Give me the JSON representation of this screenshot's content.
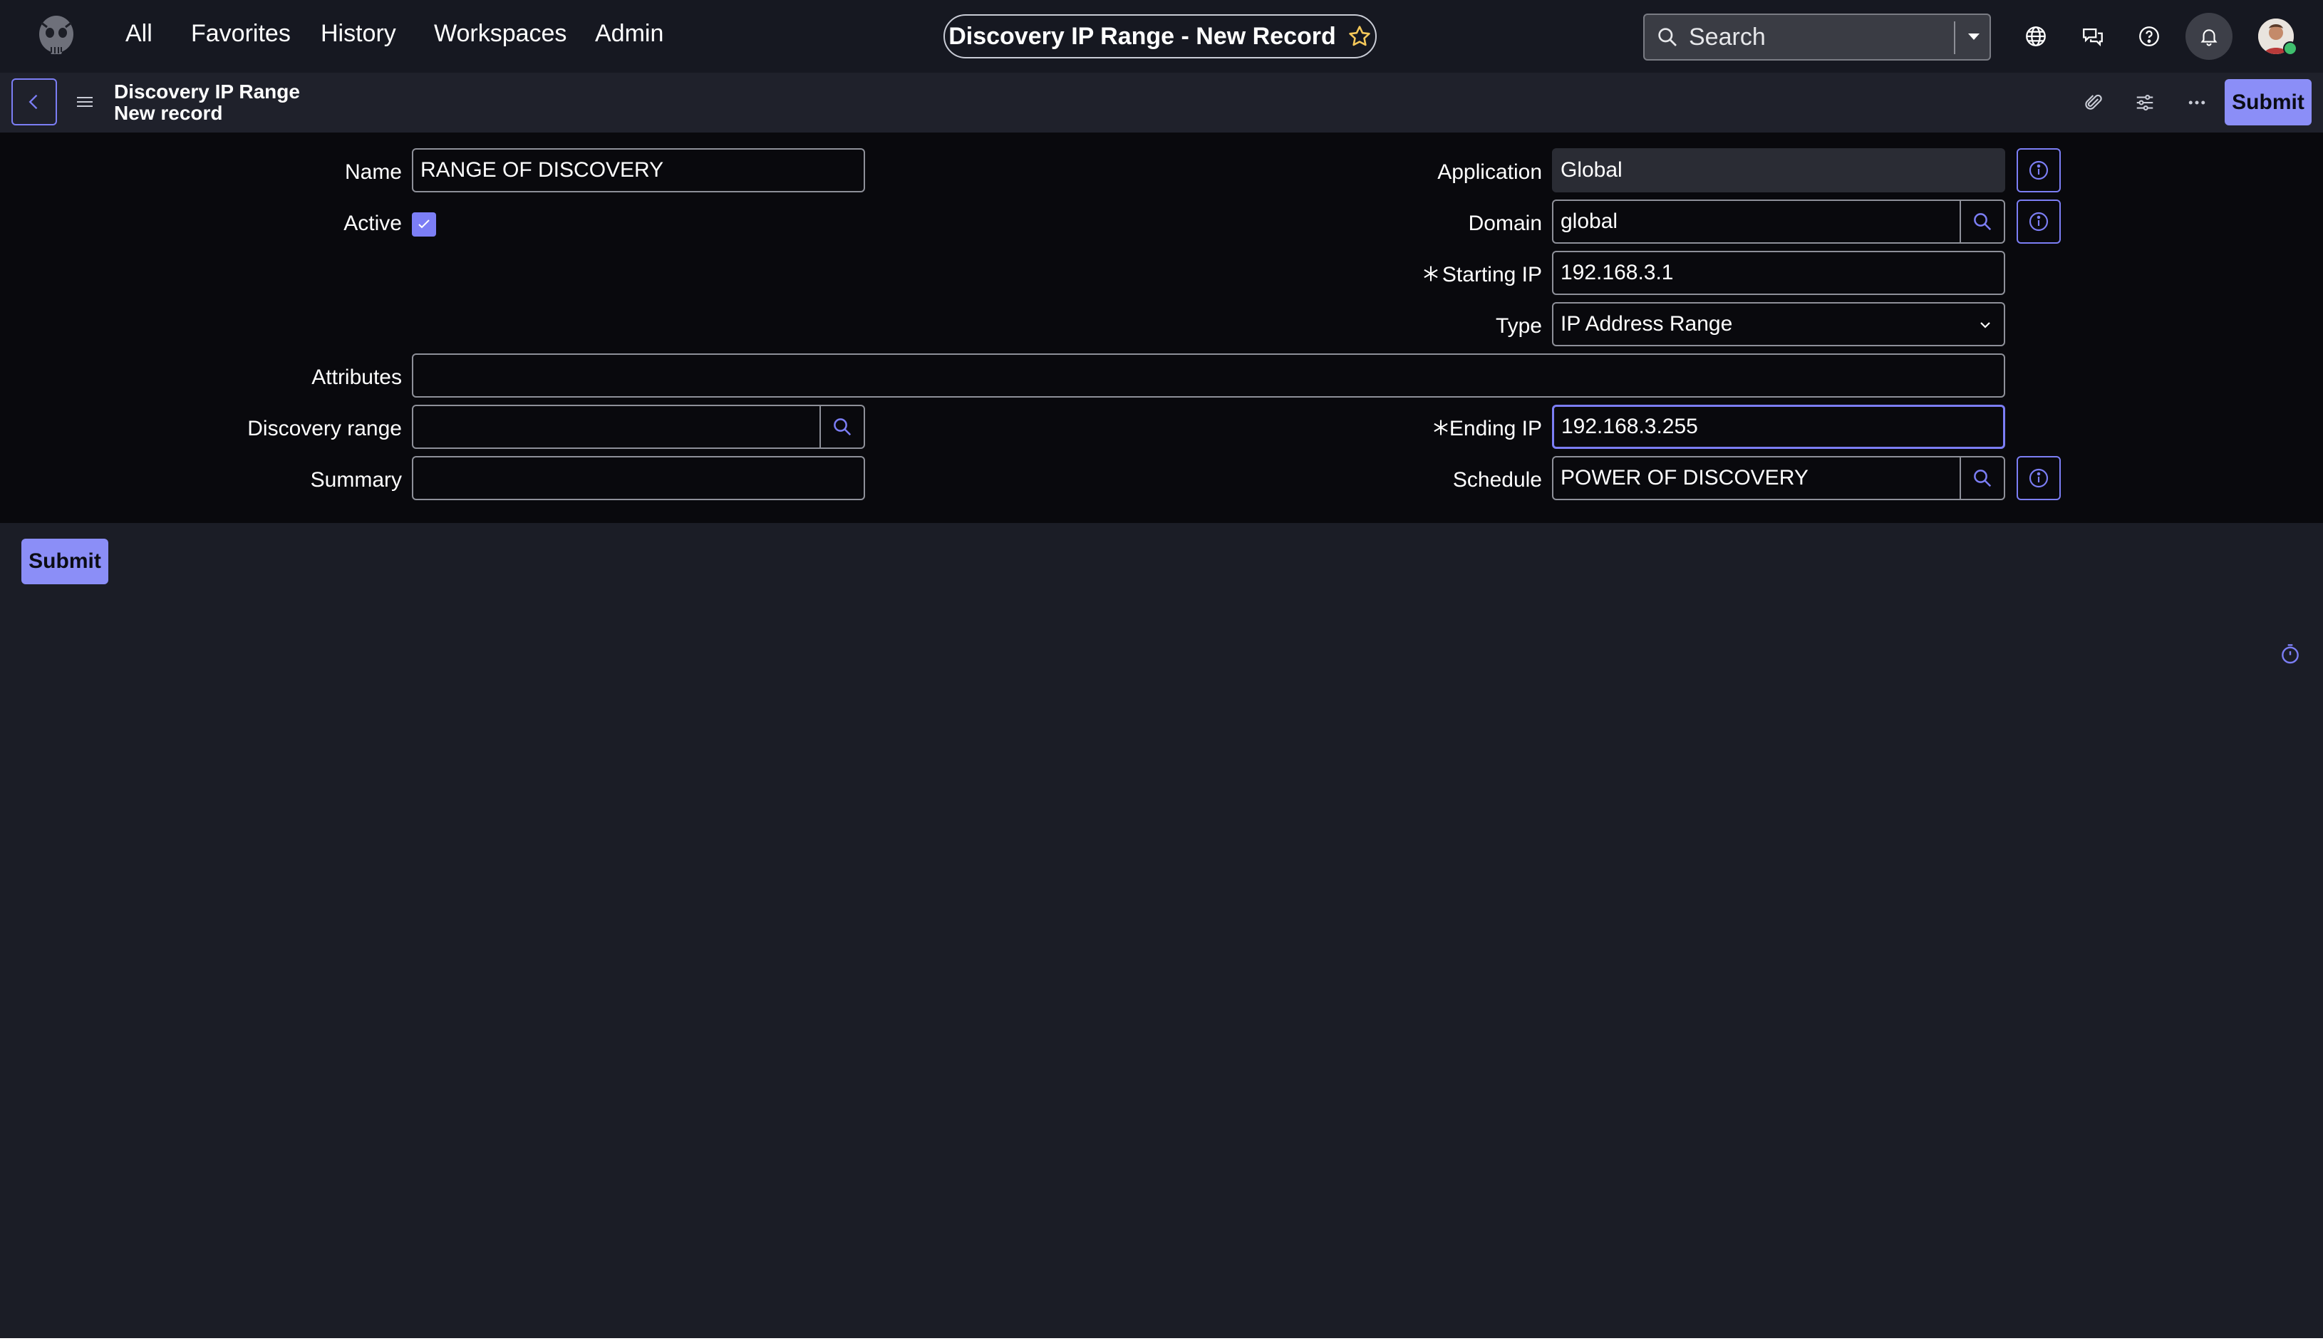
{
  "nav": {
    "items": [
      "All",
      "Favorites",
      "History",
      "Workspaces",
      "Admin"
    ],
    "page_title": "Discovery IP Range - New Record",
    "search_placeholder": "Search"
  },
  "header": {
    "breadcrumb_title": "Discovery IP Range",
    "breadcrumb_subtitle": "New record",
    "submit_label": "Submit"
  },
  "form": {
    "name": {
      "label": "Name",
      "value": "RANGE OF DISCOVERY"
    },
    "active": {
      "label": "Active",
      "checked": true
    },
    "attributes": {
      "label": "Attributes",
      "value": ""
    },
    "discovery_range": {
      "label": "Discovery range",
      "value": ""
    },
    "summary": {
      "label": "Summary",
      "value": ""
    },
    "application": {
      "label": "Application",
      "value": "Global"
    },
    "domain": {
      "label": "Domain",
      "value": "global"
    },
    "starting_ip": {
      "label": "Starting IP",
      "value": "192.168.3.1",
      "required": true
    },
    "type": {
      "label": "Type",
      "value": "IP Address Range"
    },
    "ending_ip": {
      "label": "Ending IP",
      "value": "192.168.3.255",
      "required": true
    },
    "schedule": {
      "label": "Schedule",
      "value": "POWER OF DISCOVERY"
    }
  },
  "footer": {
    "submit_label": "Submit"
  },
  "colors": {
    "accent": "#7c7ef5",
    "button": "#8b8ef7",
    "star": "#f5c85a"
  },
  "icons": [
    "logo-icon",
    "star-icon",
    "search-icon",
    "globe-icon",
    "chat-icon",
    "help-icon",
    "bell-icon",
    "paperclip-icon",
    "sliders-icon",
    "more-icon",
    "back-icon",
    "menu-icon",
    "info-icon",
    "timer-icon"
  ]
}
